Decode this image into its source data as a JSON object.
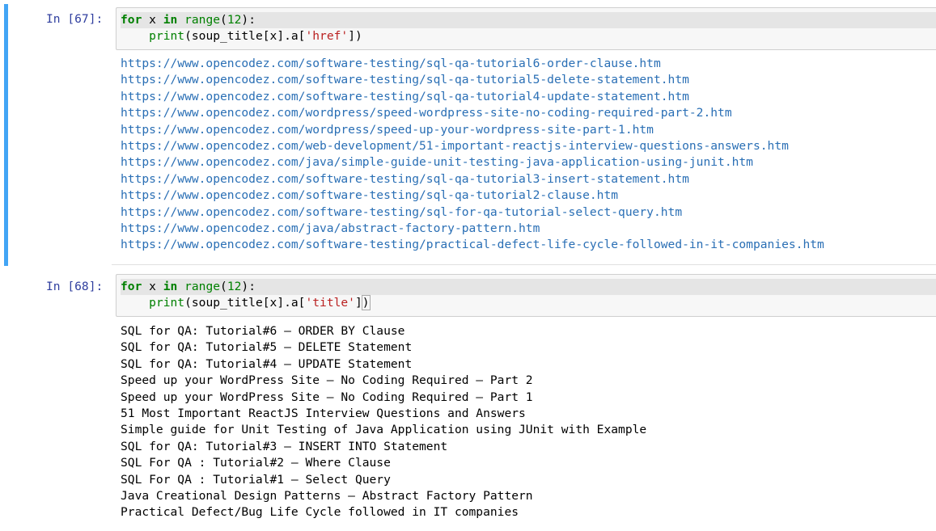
{
  "cells": [
    {
      "prompt": "In [67]:",
      "code": {
        "line1": {
          "kw_for": "for",
          "var": " x ",
          "kw_in": "in",
          "sp": " ",
          "fn": "range",
          "open": "(",
          "num": "12",
          "close": "):"
        },
        "line2": {
          "indent": "    ",
          "fn": "print",
          "pre": "(soup_title[x].a[",
          "str": "'href'",
          "post": "])"
        }
      },
      "output": [
        "https://www.opencodez.com/software-testing/sql-qa-tutorial6-order-clause.htm",
        "https://www.opencodez.com/software-testing/sql-qa-tutorial5-delete-statement.htm",
        "https://www.opencodez.com/software-testing/sql-qa-tutorial4-update-statement.htm",
        "https://www.opencodez.com/wordpress/speed-wordpress-site-no-coding-required-part-2.htm",
        "https://www.opencodez.com/wordpress/speed-up-your-wordpress-site-part-1.htm",
        "https://www.opencodez.com/web-development/51-important-reactjs-interview-questions-answers.htm",
        "https://www.opencodez.com/java/simple-guide-unit-testing-java-application-using-junit.htm",
        "https://www.opencodez.com/software-testing/sql-qa-tutorial3-insert-statement.htm",
        "https://www.opencodez.com/software-testing/sql-qa-tutorial2-clause.htm",
        "https://www.opencodez.com/software-testing/sql-for-qa-tutorial-select-query.htm",
        "https://www.opencodez.com/java/abstract-factory-pattern.htm",
        "https://www.opencodez.com/software-testing/practical-defect-life-cycle-followed-in-it-companies.htm"
      ]
    },
    {
      "prompt": "In [68]:",
      "code": {
        "line1": {
          "kw_for": "for",
          "var": " x ",
          "kw_in": "in",
          "sp": " ",
          "fn": "range",
          "open": "(",
          "num": "12",
          "close": "):"
        },
        "line2": {
          "indent": "    ",
          "fn": "print",
          "pre": "(soup_title[x].a[",
          "str": "'title'",
          "post": "]",
          "last": ")"
        }
      },
      "output": [
        "SQL for QA: Tutorial#6 – ORDER BY Clause",
        "SQL for QA: Tutorial#5 – DELETE Statement",
        "SQL for QA: Tutorial#4 – UPDATE Statement",
        "Speed up your WordPress Site – No Coding Required – Part 2",
        "Speed up your WordPress Site – No Coding Required – Part 1",
        "51 Most Important ReactJS Interview Questions and Answers",
        "Simple guide for Unit Testing of Java Application using JUnit with Example",
        "SQL for QA: Tutorial#3 – INSERT INTO Statement",
        "SQL For QA : Tutorial#2 – Where Clause",
        "SQL For QA : Tutorial#1 – Select Query",
        "Java Creational Design Patterns – Abstract Factory Pattern",
        "Practical Defect/Bug Life Cycle followed in IT companies"
      ]
    }
  ]
}
